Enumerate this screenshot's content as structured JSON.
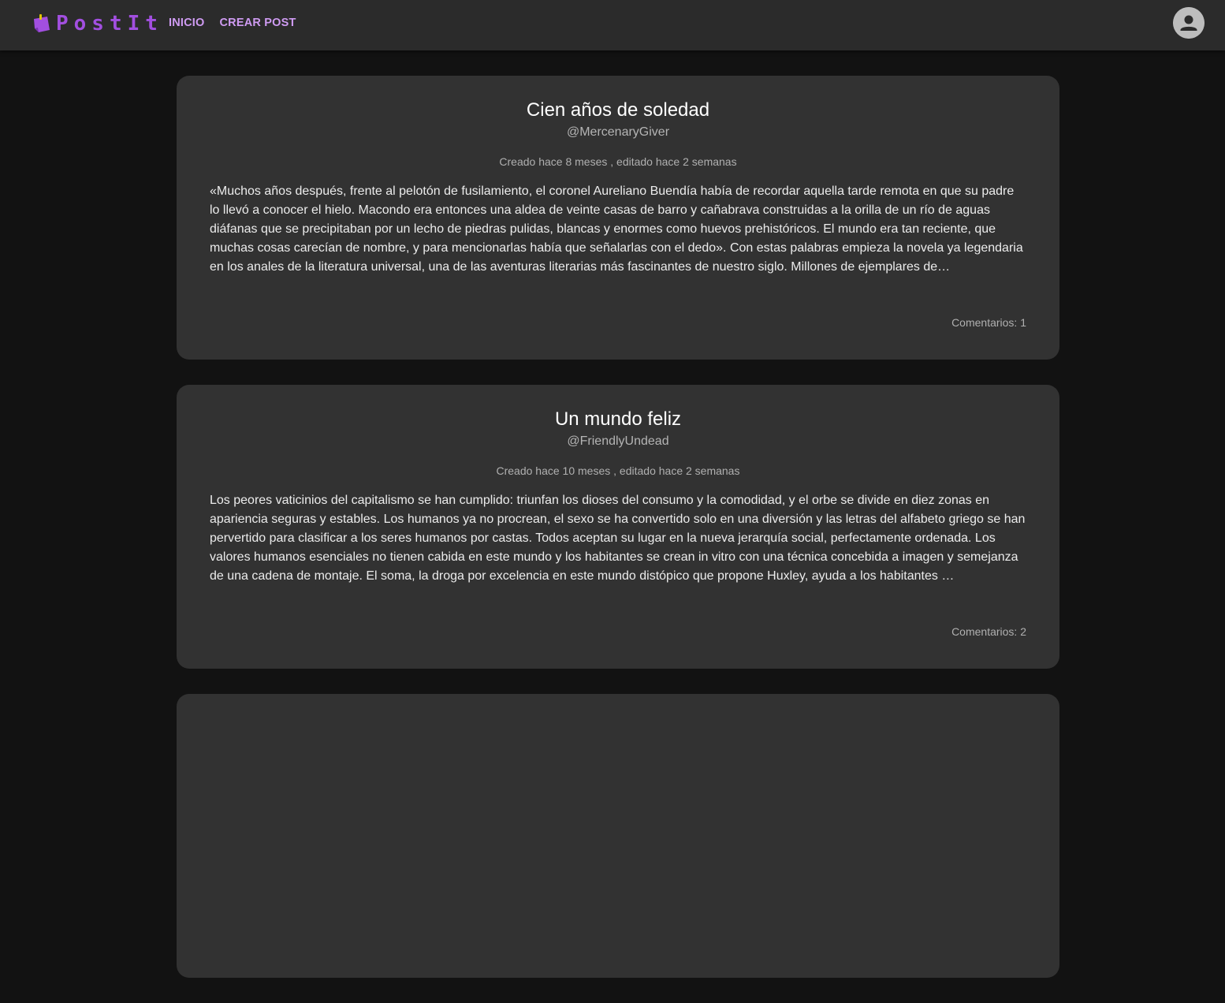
{
  "app": {
    "name": "PostIt",
    "brand_color": "#a24fe0",
    "logo_icon": "sticky-note-icon"
  },
  "nav": {
    "items": [
      {
        "label": "INICIO"
      },
      {
        "label": "CREAR POST"
      }
    ]
  },
  "user": {
    "avatar_icon": "account-circle-icon"
  },
  "posts": [
    {
      "title": "Cien años de soledad",
      "author": "@MercenaryGiver",
      "meta": "Creado hace 8 meses , editado hace 2 semanas",
      "body": "«Muchos años después, frente al pelotón de fusilamiento, el coronel Aureliano Buendía había de recordar aquella tarde remota en que su padre lo llevó a conocer el hielo. Macondo era entonces una aldea de veinte casas de barro y cañabrava construidas a la orilla de un río de aguas diáfanas que se precipitaban por un lecho de piedras pulidas, blancas y enormes como huevos prehistóricos. El mundo era tan reciente, que muchas cosas carecían de nombre, y para mencionarlas había que señalarlas con el dedo». Con estas palabras empieza la novela ya legendaria en los anales de la literatura universal, una de las aventuras literarias más fascinantes de nuestro siglo. Millones de ejemplares de…",
      "comments": "Comentarios: 1"
    },
    {
      "title": "Un mundo feliz",
      "author": "@FriendlyUndead",
      "meta": "Creado hace 10 meses , editado hace 2 semanas",
      "body": "Los peores vaticinios del capitalismo se han cumplido: triunfan los dioses del consumo y la comodidad, y el orbe se divide en diez zonas en apariencia seguras y estables. Los humanos ya no procrean, el sexo se ha convertido solo en una diversión y las letras del alfabeto griego se han pervertido para clasificar a los seres humanos por castas. Todos aceptan su lugar en la nueva jerarquía social, perfectamente ordenada. Los valores humanos esenciales no tienen cabida en este mundo y los habitantes se crean in vitro con una técnica concebida a imagen y semejanza de una cadena de montaje. El soma, la droga por excelencia en este mundo distópico que propone Huxley, ayuda a los habitantes …",
      "comments": "Comentarios: 2"
    },
    {
      "title": "",
      "author": "",
      "meta": "",
      "body": "",
      "comments": ""
    }
  ]
}
